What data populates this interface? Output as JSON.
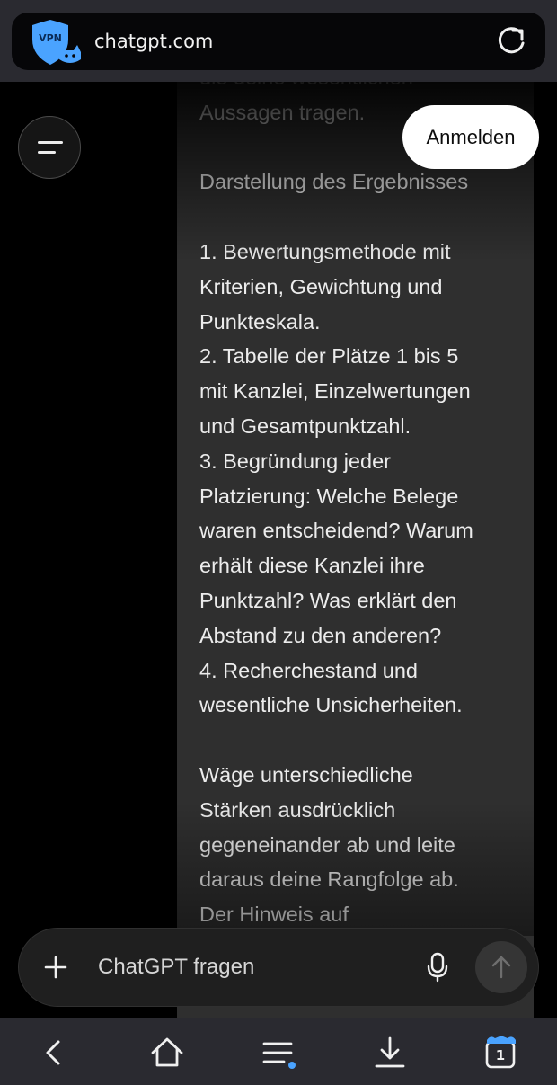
{
  "browser": {
    "url": "chatgpt.com",
    "vpn_badge": "VPN",
    "tab_count": "1"
  },
  "header": {
    "login_label": "Anmelden"
  },
  "message": {
    "lines": [
      "die deine wesentlichen",
      "Aussagen tragen.",
      "",
      "Darstellung des Ergebnisses",
      "",
      "1. Bewertungsmethode mit",
      "Kriterien, Gewichtung und",
      "Punkteskala.",
      "2. Tabelle der Plätze 1 bis 5",
      "mit Kanzlei, Einzelwertungen",
      "und Gesamtpunktzahl.",
      "3. Begründung jeder",
      "Platzierung: Welche Belege",
      "waren entscheidend? Warum",
      "erhält diese Kanzlei ihre",
      "Punktzahl? Was erklärt den",
      "Abstand zu den anderen?",
      "4. Recherchestand und",
      "wesentliche Unsicherheiten.",
      "",
      "Wäge unterschiedliche",
      "Stärken ausdrücklich",
      "gegeneinander ab und leite",
      "daraus deine Rangfolge ab.",
      "Der Hinweis auf"
    ]
  },
  "composer": {
    "placeholder": "ChatGPT fragen"
  },
  "icons": {
    "menu": "menu-icon",
    "reload": "reload-icon",
    "plus": "plus-icon",
    "mic": "microphone-icon",
    "send": "arrow-up-icon",
    "back": "back-icon",
    "home": "home-icon",
    "tabs_menu": "menu-list-icon",
    "download": "download-icon",
    "tabs": "tabs-icon"
  },
  "colors": {
    "accent_blue": "#4aa3ff",
    "bubble": "#2f2f2f",
    "bar": "#2a2a30"
  }
}
